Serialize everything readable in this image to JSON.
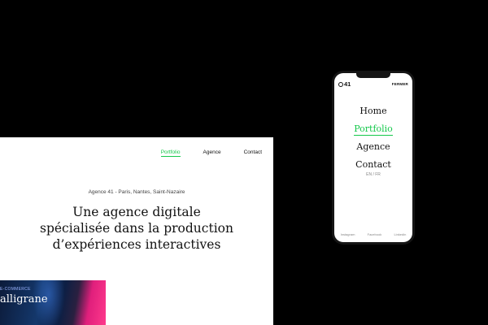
{
  "desktop": {
    "nav": [
      {
        "label": "Portfolio",
        "active": true
      },
      {
        "label": "Agence",
        "active": false
      },
      {
        "label": "Contact",
        "active": false
      }
    ],
    "meta": "Agence 41 - Paris, Nantes, Saint-Nazaire",
    "headline": [
      "Une agence digitale",
      "spécialisée dans la production",
      "d’expériences interactives"
    ],
    "card": {
      "tag": "E-COMMERCE",
      "title": "alligrane"
    }
  },
  "phone": {
    "logo": "41",
    "close_label": "FERMER",
    "menu": [
      {
        "label": "Home",
        "active": false
      },
      {
        "label": "Portfolio",
        "active": true
      },
      {
        "label": "Agence",
        "active": false
      },
      {
        "label": "Contact",
        "active": false
      }
    ],
    "lang": "EN / FR",
    "social": [
      "Instagram",
      "Facebook",
      "Linkedin"
    ]
  },
  "colors": {
    "accent": "#14c84a",
    "background": "#000000",
    "card_pink": "#e01f7c",
    "card_blue": "#14386c"
  }
}
